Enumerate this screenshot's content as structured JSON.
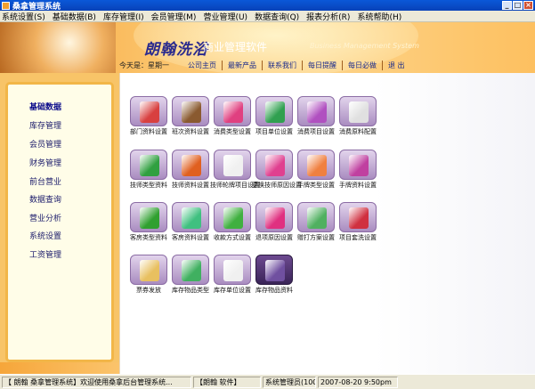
{
  "window": {
    "title": "桑拿管理系统"
  },
  "menu": [
    "系统设置(S)",
    "基础数据(B)",
    "库存管理(I)",
    "会员管理(M)",
    "营业管理(U)",
    "数据查询(Q)",
    "报表分析(R)",
    "系统帮助(H)"
  ],
  "banner": {
    "brand": "朗翰洗浴",
    "subtitle": "商业管理软件",
    "english": "Business Management System",
    "today": "今天是：星期一",
    "nav": [
      "公司主页",
      "最新产品",
      "联系我们",
      "每日提醒",
      "每日必做",
      "退 出"
    ]
  },
  "sidebar": [
    "基础数据",
    "库存管理",
    "会员管理",
    "财务管理",
    "前台营业",
    "数据查询",
    "营业分析",
    "系统设置",
    "工资管理"
  ],
  "tiles": [
    {
      "label": "部门资料设置",
      "color": "#d84040"
    },
    {
      "label": "班次资料设置",
      "color": "#8a5a30"
    },
    {
      "label": "消费类型设置",
      "color": "#e04080"
    },
    {
      "label": "项目单位设置",
      "color": "#30a050"
    },
    {
      "label": "消费项目设置",
      "color": "#b050c0"
    },
    {
      "label": "消费原料配置",
      "color": "#e0e0e0"
    },
    {
      "label": "技师类型资料",
      "color": "#30a040"
    },
    {
      "label": "技师资料设置",
      "color": "#e06020"
    },
    {
      "label": "技师轮牌项目设置",
      "color": "#f0f0f0"
    },
    {
      "label": "更换技师原因设置",
      "color": "#e04090"
    },
    {
      "label": "手牌类型设置",
      "color": "#f08040"
    },
    {
      "label": "手牌资料设置",
      "color": "#c040a0"
    },
    {
      "label": "客房类型资料",
      "color": "#30a030"
    },
    {
      "label": "客房资料设置",
      "color": "#40c080"
    },
    {
      "label": "收款方式设置",
      "color": "#40b040"
    },
    {
      "label": "退项原因设置",
      "color": "#e03080"
    },
    {
      "label": "赠打方案设置",
      "color": "#50b060"
    },
    {
      "label": "项目套洗设置",
      "color": "#d03040"
    },
    {
      "label": "票券发放",
      "color": "#e8c060"
    },
    {
      "label": "库存物品类型",
      "color": "#40b060"
    },
    {
      "label": "库存单位设置",
      "color": "#f0f0f0"
    },
    {
      "label": "库存物品资料",
      "color": "#7050a0"
    }
  ],
  "status": {
    "app": "【 朗翰 桑拿管理系统】欢迎使用桑拿后台管理系统...",
    "company": "【朗翰 软件】",
    "user": "系统管理员(1001)",
    "time": "2007-08-20 9:50pm"
  }
}
